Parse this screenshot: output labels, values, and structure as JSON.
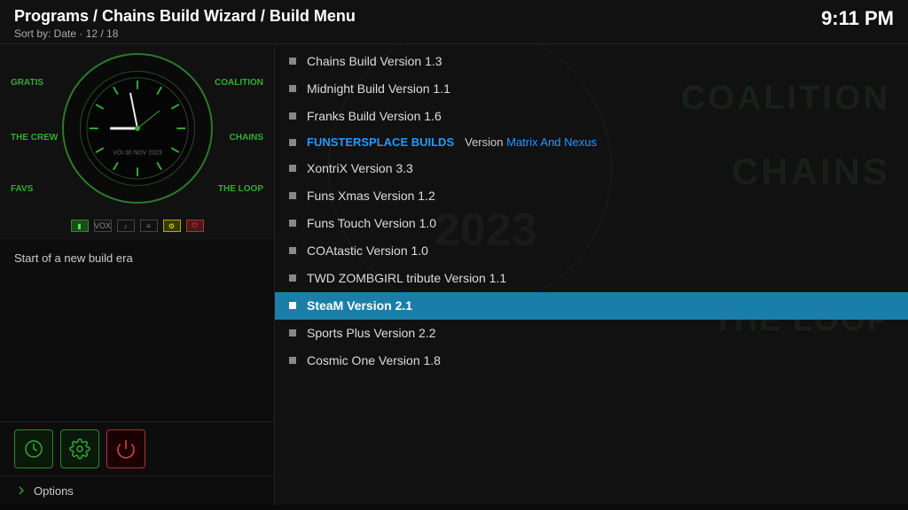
{
  "header": {
    "breadcrumb": "Programs / Chains Build Wizard / Build Menu",
    "sort_info": "Sort by: Date  ·  12 / 18",
    "time": "9:11 PM"
  },
  "left_panel": {
    "description": "Start of a new build era",
    "bottom_icons": [
      {
        "name": "gear-icon-1"
      },
      {
        "name": "gear-icon-2"
      },
      {
        "name": "power-icon"
      }
    ],
    "options_label": "Options",
    "labels": {
      "gratis": "GRATIS",
      "coalition": "COALITION",
      "the_crew": "THE CREW",
      "chains": "CHAINS",
      "favs": "FAVS",
      "the_loop": "THE LOOP"
    }
  },
  "menu": {
    "items": [
      {
        "id": 1,
        "label": "Chains Build Version 1.3",
        "active": false
      },
      {
        "id": 2,
        "label": "Midnight Build Version 1.1",
        "active": false
      },
      {
        "id": 3,
        "label": "Franks Build Version 1.6",
        "active": false
      },
      {
        "id": 4,
        "label": "FUNSTERSPLACE BUILDS",
        "type": "funsters",
        "version_label": "Version",
        "version_value": "Matrix And Nexus"
      },
      {
        "id": 5,
        "label": "XontriX Version 3.3",
        "active": false
      },
      {
        "id": 6,
        "label": "Funs Xmas Version 1.2",
        "active": false
      },
      {
        "id": 7,
        "label": "Funs Touch Version 1.0",
        "active": false
      },
      {
        "id": 8,
        "label": "COAtastic Version 1.0",
        "active": false
      },
      {
        "id": 9,
        "label": "TWD ZOMBGIRL tribute Version 1.1",
        "active": false
      },
      {
        "id": 10,
        "label": "SteaM Version 2.1",
        "active": true
      },
      {
        "id": 11,
        "label": "Sports Plus Version 2.2",
        "active": false
      },
      {
        "id": 12,
        "label": "Cosmic One Version 1.8",
        "active": false
      }
    ]
  },
  "watermarks": {
    "coalition": "COALITION",
    "chains": "CHAINS",
    "the_loop": "THE LOOP",
    "year": "2023"
  }
}
